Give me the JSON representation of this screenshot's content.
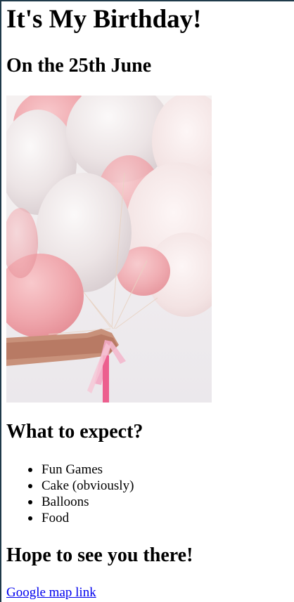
{
  "page": {
    "title": "It's My Birthday!",
    "date_heading": "On the 25th June",
    "expect_heading": "What to expect?",
    "expect_items": [
      "Fun Games",
      "Cake (obviously)",
      "Balloons",
      "Food"
    ],
    "closing_heading": "Hope to see you there!",
    "map_link_label": "Google map link"
  },
  "colors": {
    "link": "#0000ee",
    "text": "#000000",
    "frame": "#1f3a4a"
  }
}
